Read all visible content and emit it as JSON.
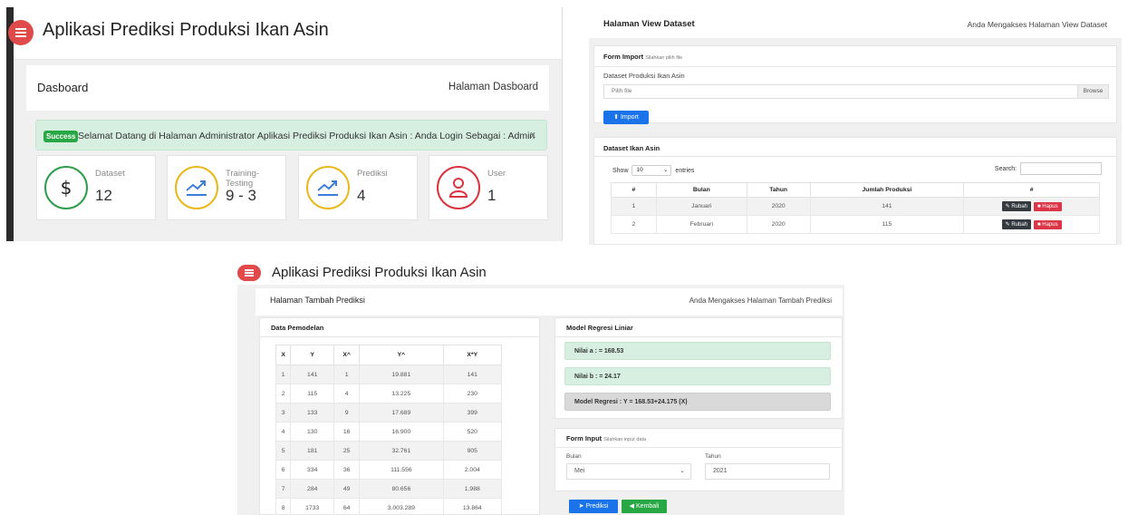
{
  "dashboard": {
    "app_title": "Aplikasi Prediksi Produksi Ikan Asin",
    "page_title": "Dasboard",
    "page_subtitle": "Halaman Dasboard",
    "alert": {
      "badge": "Success",
      "message": "Selamat Datang di Halaman Administrator Aplikasi Prediksi Produksi Ikan Asin : Anda Login Sebagai : Admin",
      "close": "x"
    },
    "stats": [
      {
        "label": "Dataset",
        "value": "12",
        "icon": "dollar-icon",
        "color": "#2e9e4b"
      },
      {
        "label": "Training-Testing",
        "value": "9 - 3",
        "icon": "trend-up-icon",
        "color": "#e8b81c"
      },
      {
        "label": "Prediksi",
        "value": "4",
        "icon": "trend-up-icon",
        "color": "#e8b81c"
      },
      {
        "label": "User",
        "value": "1",
        "icon": "user-icon",
        "color": "#d9343f"
      }
    ]
  },
  "dataset": {
    "page_title": "Halaman View Dataset",
    "page_subtitle": "Anda Mengakses Halaman View Dataset",
    "form_import": {
      "title": "Form Import",
      "hint": "Silahkan pilih file",
      "field_label": "Dataset Produksi Ikan Asin",
      "file_placeholder": "Pilih file",
      "browse": "Browse",
      "import_button": "Import"
    },
    "table_card_title": "Dataset Ikan Asin",
    "show_label": "Show",
    "show_value": "10",
    "entries_label": "entries",
    "search_label": "Search:",
    "columns": [
      "#",
      "Bulan",
      "Tahun",
      "Jumlah Produksi",
      "#"
    ],
    "rows": [
      {
        "no": "1",
        "bulan": "Januari",
        "tahun": "2020",
        "jumlah": "141"
      },
      {
        "no": "2",
        "bulan": "Februari",
        "tahun": "2020",
        "jumlah": "115"
      }
    ],
    "btn_ubah": "Rubah",
    "btn_hapus": "Hapus"
  },
  "prediksi": {
    "app_title": "Aplikasi Prediksi Produksi Ikan Asin",
    "page_title": "Halaman Tambah Prediksi",
    "page_subtitle": "Anda Mengakses Halaman Tambah Prediksi",
    "model_card_title": "Data Pemodelan",
    "columns": [
      "X",
      "Y",
      "X^",
      "Y^",
      "X*Y"
    ],
    "rows": [
      [
        "1",
        "141",
        "1",
        "19.881",
        "141"
      ],
      [
        "2",
        "115",
        "4",
        "13.225",
        "230"
      ],
      [
        "3",
        "133",
        "9",
        "17.689",
        "399"
      ],
      [
        "4",
        "130",
        "16",
        "16.900",
        "520"
      ],
      [
        "5",
        "181",
        "25",
        "32.761",
        "905"
      ],
      [
        "6",
        "334",
        "36",
        "111.556",
        "2.004"
      ],
      [
        "7",
        "284",
        "49",
        "80.656",
        "1.988"
      ],
      [
        "8",
        "1733",
        "64",
        "3.003.289",
        "13.864"
      ]
    ],
    "regresi_title": "Model Regresi Liniar",
    "nilai_a": "Nilai a : = 168.53",
    "nilai_b": "Nilai b : = 24.17",
    "model": "Model Regresi : Y = 168.53+24.175 (X)",
    "form_input_title": "Form Input",
    "form_input_hint": "Silahkan input data",
    "bulan_label": "Bulan",
    "bulan_value": "Mei",
    "tahun_label": "Tahun",
    "tahun_value": "2021",
    "btn_prediksi": "Prediksi",
    "btn_kembali": "Kembali"
  }
}
